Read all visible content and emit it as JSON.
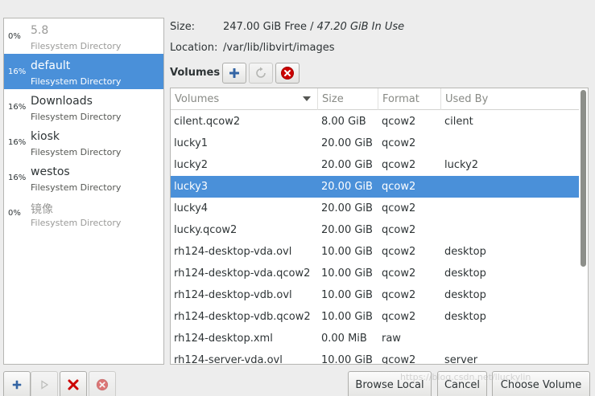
{
  "pools": [
    {
      "pct": "0%",
      "name": "5.8",
      "type": "Filesystem Directory",
      "state": "inactive"
    },
    {
      "pct": "16%",
      "name": "default",
      "type": "Filesystem Directory",
      "state": "selected"
    },
    {
      "pct": "16%",
      "name": "Downloads",
      "type": "Filesystem Directory",
      "state": "active"
    },
    {
      "pct": "16%",
      "name": "kiosk",
      "type": "Filesystem Directory",
      "state": "active"
    },
    {
      "pct": "16%",
      "name": "westos",
      "type": "Filesystem Directory",
      "state": "active"
    },
    {
      "pct": "0%",
      "name": "镜像",
      "type": "Filesystem Directory",
      "state": "inactive"
    }
  ],
  "info": {
    "size_label": "Size:",
    "size_free": "247.00 GiB Free / ",
    "size_used": "47.20 GiB In Use",
    "location_label": "Location:",
    "location_value": "/var/lib/libvirt/images"
  },
  "volumes_header": "Volumes",
  "toolbar_icons": {
    "add": "plus-icon",
    "refresh": "refresh-icon",
    "delete": "delete-icon"
  },
  "table": {
    "columns": [
      "Volumes",
      "Size",
      "Format",
      "Used By"
    ],
    "rows": [
      {
        "name": "cilent.qcow2",
        "size": "8.00 GiB",
        "format": "qcow2",
        "used_by": "cilent"
      },
      {
        "name": "lucky1",
        "size": "20.00 GiB",
        "format": "qcow2",
        "used_by": ""
      },
      {
        "name": "lucky2",
        "size": "20.00 GiB",
        "format": "qcow2",
        "used_by": "lucky2"
      },
      {
        "name": "lucky3",
        "size": "20.00 GiB",
        "format": "qcow2",
        "used_by": "",
        "selected": true
      },
      {
        "name": "lucky4",
        "size": "20.00 GiB",
        "format": "qcow2",
        "used_by": ""
      },
      {
        "name": "lucky.qcow2",
        "size": "20.00 GiB",
        "format": "qcow2",
        "used_by": ""
      },
      {
        "name": "rh124-desktop-vda.ovl",
        "size": "10.00 GiB",
        "format": "qcow2",
        "used_by": "desktop"
      },
      {
        "name": "rh124-desktop-vda.qcow2",
        "size": "10.00 GiB",
        "format": "qcow2",
        "used_by": "desktop"
      },
      {
        "name": "rh124-desktop-vdb.ovl",
        "size": "10.00 GiB",
        "format": "qcow2",
        "used_by": "desktop"
      },
      {
        "name": "rh124-desktop-vdb.qcow2",
        "size": "10.00 GiB",
        "format": "qcow2",
        "used_by": "desktop"
      },
      {
        "name": "rh124-desktop.xml",
        "size": "0.00 MiB",
        "format": "raw",
        "used_by": ""
      },
      {
        "name": "rh124-server-vda.ovl",
        "size": "10.00 GiB",
        "format": "qcow2",
        "used_by": "server"
      }
    ]
  },
  "bottom": {
    "browse_local": "Browse Local",
    "cancel": "Cancel",
    "choose_volume": "Choose Volume",
    "watermark": "https://blog.csdn.net/lluckylin"
  },
  "colors": {
    "selection": "#4a90d9",
    "delete_red": "#cc0000",
    "add_blue": "#3465a4"
  }
}
